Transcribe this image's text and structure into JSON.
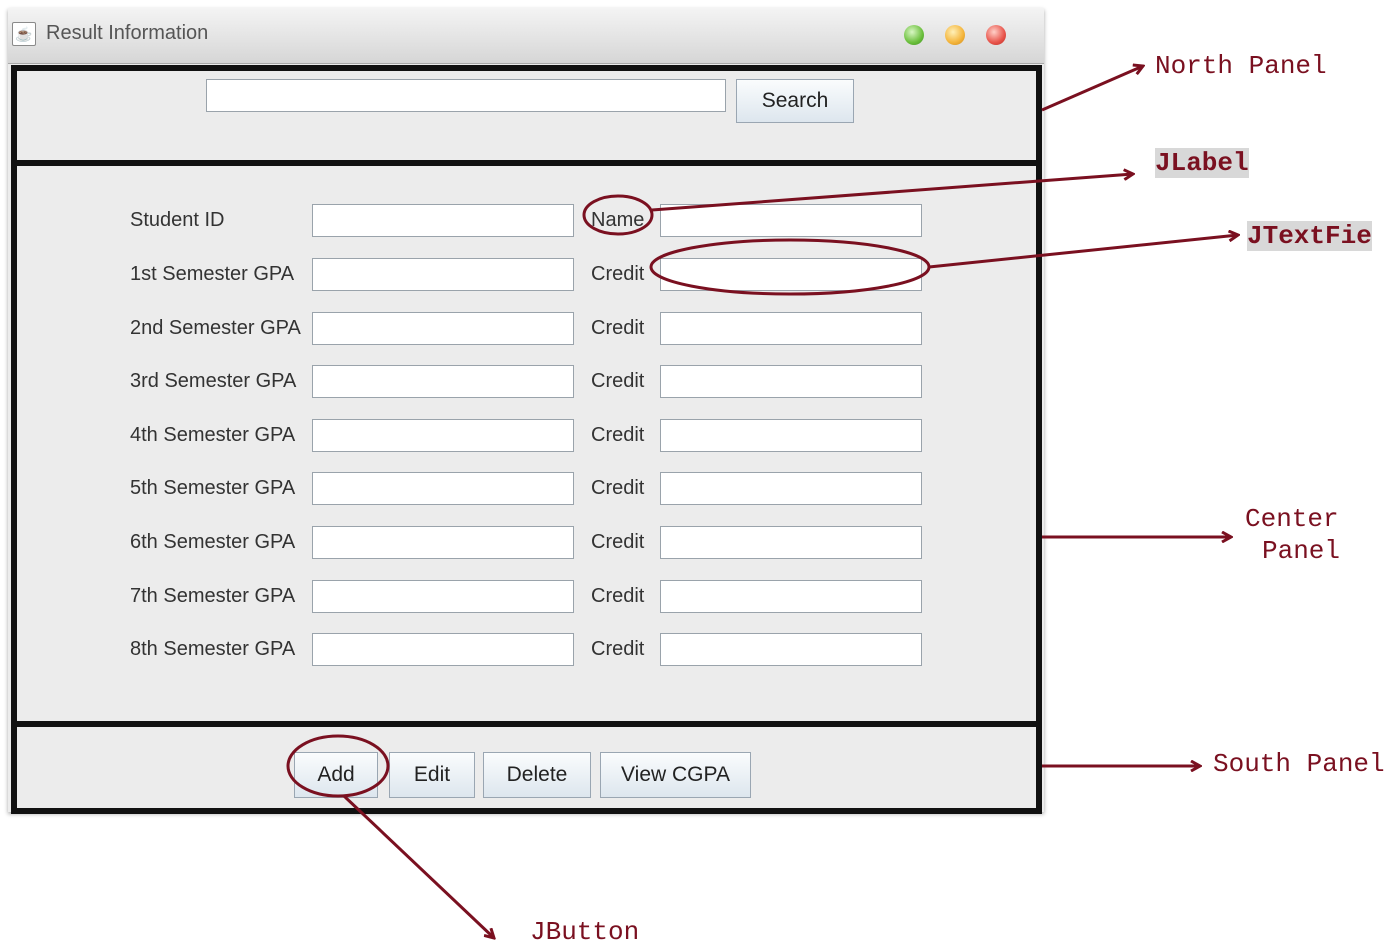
{
  "window": {
    "title": "Result Information"
  },
  "north": {
    "search_value": "",
    "search_button": "Search"
  },
  "center": {
    "student_id_label": "Student ID",
    "name_label": "Name",
    "rows": [
      {
        "gpa_label": "1st Semester GPA",
        "credit_label": "Credit"
      },
      {
        "gpa_label": "2nd Semester GPA",
        "credit_label": "Credit"
      },
      {
        "gpa_label": "3rd Semester GPA",
        "credit_label": "Credit"
      },
      {
        "gpa_label": "4th Semester GPA",
        "credit_label": "Credit"
      },
      {
        "gpa_label": "5th Semester GPA",
        "credit_label": "Credit"
      },
      {
        "gpa_label": "6th Semester GPA",
        "credit_label": "Credit"
      },
      {
        "gpa_label": "7th Semester GPA",
        "credit_label": "Credit"
      },
      {
        "gpa_label": "8th Semester GPA",
        "credit_label": "Credit"
      }
    ]
  },
  "south": {
    "buttons": [
      "Add",
      "Edit",
      "Delete",
      "View CGPA"
    ]
  },
  "annotations": {
    "north_panel": "North Panel",
    "jlabel": "JLabel",
    "jtextfield": "JTextFie",
    "center_panel_line1": "Center",
    "center_panel_line2": "Panel",
    "south_panel": "South Panel",
    "jbutton": "JButton"
  },
  "colors": {
    "annotation": "#7a1020",
    "panel_border": "#111111",
    "window_bg": "#ececec"
  },
  "icons": {
    "app": "java-cup-icon",
    "window_controls": [
      "minimize-green",
      "zoom-yellow",
      "close-red"
    ]
  }
}
